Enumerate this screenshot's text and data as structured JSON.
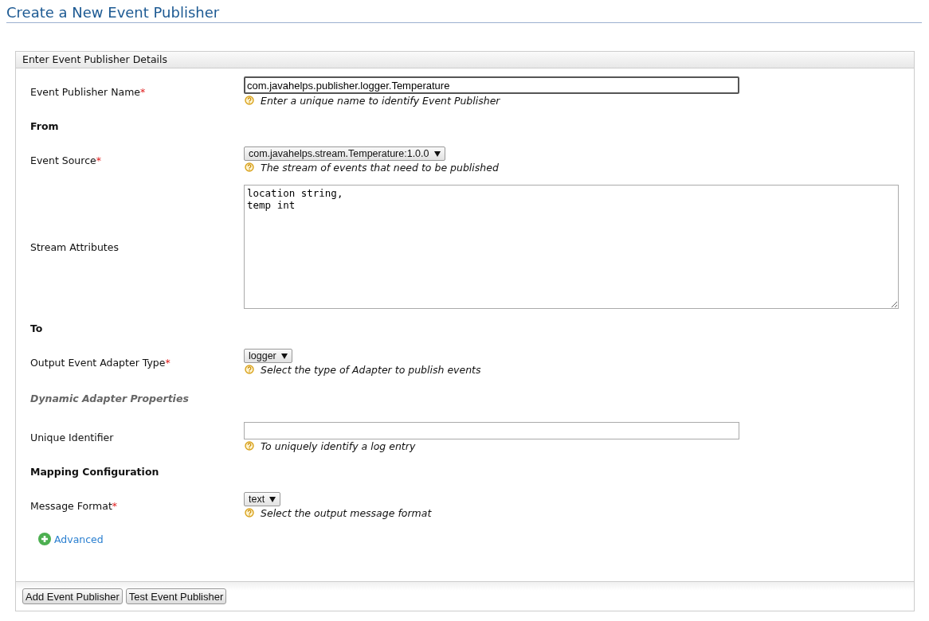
{
  "page_title": "Create a New Event Publisher",
  "panel": {
    "title": "Enter Event Publisher Details",
    "rows": [
      {
        "kind": "input",
        "label": "Event Publisher Name",
        "required_mark": "*",
        "value": "com.javahelps.publisher.logger.Temperature",
        "help": "Enter a unique name to identify Event Publisher",
        "focused": true
      },
      {
        "kind": "heading",
        "label": "From"
      },
      {
        "kind": "select",
        "label": "Event Source",
        "required_mark": "*",
        "value": "com.javahelps.stream.Temperature:1.0.0",
        "help": "The stream of events that need to be published"
      },
      {
        "kind": "textarea",
        "label": "Stream Attributes",
        "value": "location string,\ntemp int"
      },
      {
        "kind": "heading",
        "label": "To"
      },
      {
        "kind": "select",
        "label": "Output Event Adapter Type",
        "required_mark": "*",
        "value": "logger",
        "help": "Select the type of Adapter to publish events"
      },
      {
        "kind": "subheading",
        "label": "Dynamic Adapter Properties"
      },
      {
        "kind": "input",
        "label": "Unique Identifier",
        "value": "",
        "help": "To uniquely identify a log entry",
        "focused": false
      },
      {
        "kind": "heading",
        "label": "Mapping Configuration"
      },
      {
        "kind": "select",
        "label": "Message Format",
        "required_mark": "*",
        "value": "text",
        "help": "Select the output message format"
      }
    ],
    "advanced_link": "Advanced",
    "buttons": [
      "Add Event Publisher",
      "Test Event Publisher"
    ]
  }
}
